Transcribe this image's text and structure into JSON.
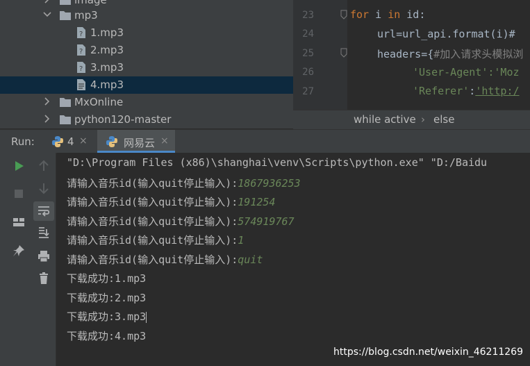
{
  "project_tree": {
    "items": [
      {
        "label": "image",
        "kind": "folder",
        "expanded": false
      },
      {
        "label": "mp3",
        "kind": "folder",
        "expanded": true
      },
      {
        "label": "1.mp3",
        "kind": "file"
      },
      {
        "label": "2.mp3",
        "kind": "file"
      },
      {
        "label": "3.mp3",
        "kind": "file"
      },
      {
        "label": "4.mp3",
        "kind": "file",
        "selected": true
      },
      {
        "label": "MxOnline",
        "kind": "folder",
        "expanded": false
      },
      {
        "label": "python120-master",
        "kind": "folder",
        "expanded": false
      }
    ]
  },
  "editor": {
    "line_numbers": [
      "23",
      "24",
      "25",
      "26",
      "27"
    ],
    "lines": {
      "l23_kw": "for",
      "l23_a": " i ",
      "l23_kw2": "in",
      "l23_b": " id:",
      "l24": "url=url_api.format(i)#",
      "l25_a": "headers={",
      "l25_cmt": "#加入请求头模拟浏",
      "l26": "'User-Agent':'Moz",
      "l27_a": "'Referer'",
      "l27_b": ":",
      "l27_c": "'http:/"
    },
    "breadcrumbs": [
      "while active",
      "else"
    ]
  },
  "run_panel": {
    "label": "Run:",
    "tabs": [
      {
        "label": "4",
        "close": "×"
      },
      {
        "label": "网易云",
        "close": "×",
        "active": true
      }
    ]
  },
  "console": {
    "command": "\"D:\\Program Files (x86)\\shanghai\\venv\\Scripts\\python.exe\" \"D:/Baidu",
    "prompt": "请输入音乐id(输入quit停止输入):",
    "inputs": [
      "1867936253",
      "191254",
      "574919767",
      "1",
      "quit"
    ],
    "results": [
      "下载成功:1.mp3",
      "下载成功:2.mp3",
      "下载成功:3.mp3",
      "下载成功:4.mp3"
    ]
  },
  "watermark": "https://blog.csdn.net/weixin_46211269",
  "colors": {
    "accent": "#4a88c7",
    "input_green": "#6a8759",
    "keyword_orange": "#cc7832",
    "run_green": "#499c54",
    "selection": "#0d293e"
  }
}
